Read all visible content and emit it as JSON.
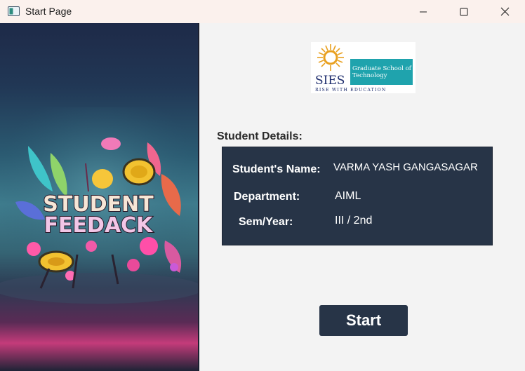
{
  "window": {
    "title": "Start Page",
    "controls": [
      "minimize",
      "maximize",
      "close"
    ]
  },
  "hero": {
    "poster_text_line1": "STUDENT",
    "poster_text_line2": "FEEDACK"
  },
  "logo": {
    "brand": "SIES",
    "tagline_line1": "Graduate School of",
    "tagline_line2": "Technology",
    "motto": "RISE WITH EDUCATION",
    "accent_color": "#1fa3ad",
    "sun_color": "#e8a020"
  },
  "student_details": {
    "section_title": "Student Details:",
    "name_label": "Student's Name:",
    "name_value": "VARMA YASH GANGASAGAR",
    "department_label": "Department:",
    "department_value": "AIML",
    "semyear_label": "Sem/Year:",
    "semyear_value": "III / 2nd"
  },
  "actions": {
    "start_label": "Start"
  },
  "colors": {
    "card_bg": "#273447",
    "page_bg": "#f3f3f3",
    "titlebar_bg": "#fbf1ed"
  }
}
